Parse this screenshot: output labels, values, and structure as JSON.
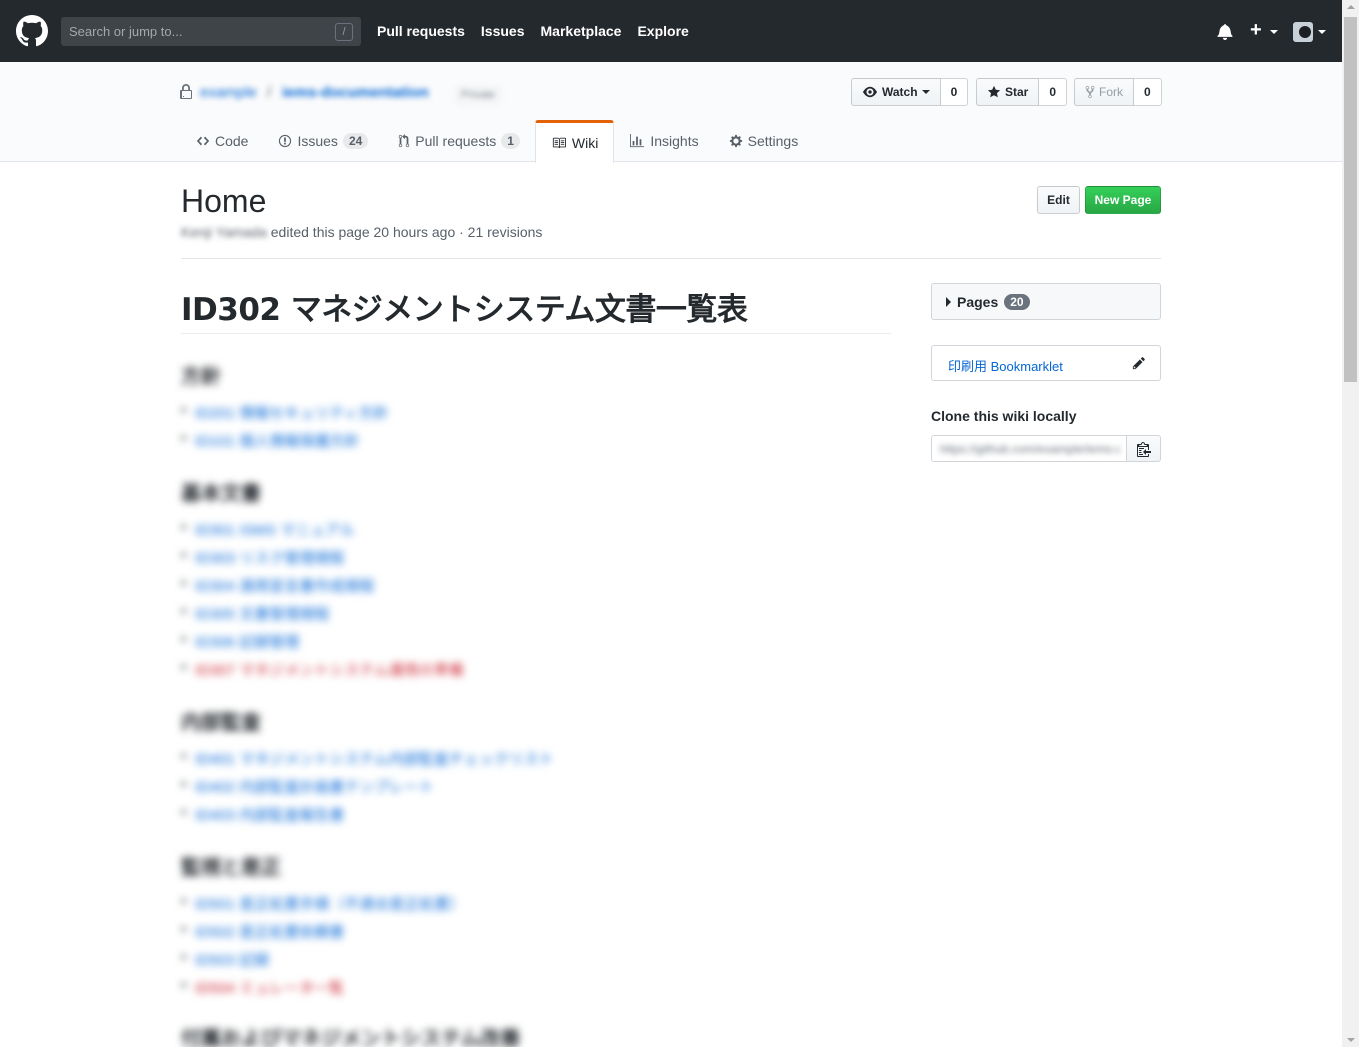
{
  "header": {
    "search_placeholder": "Search or jump to...",
    "search_shortcut": "/",
    "nav": [
      "Pull requests",
      "Issues",
      "Marketplace",
      "Explore"
    ]
  },
  "repo": {
    "owner": "example",
    "slash": "/",
    "name": "iems-documentation",
    "visibility": "Private",
    "watch_label": "Watch",
    "watch_count": "0",
    "star_label": "Star",
    "star_count": "0",
    "fork_label": "Fork",
    "fork_count": "0"
  },
  "tabs": [
    {
      "label": "Code",
      "icon": "code-icon",
      "count": ""
    },
    {
      "label": "Issues",
      "icon": "issue-icon",
      "count": "24"
    },
    {
      "label": "Pull requests",
      "icon": "pull-request-icon",
      "count": "1"
    },
    {
      "label": "Wiki",
      "icon": "book-icon",
      "count": ""
    },
    {
      "label": "Insights",
      "icon": "graph-icon",
      "count": ""
    },
    {
      "label": "Settings",
      "icon": "gear-icon",
      "count": ""
    }
  ],
  "page": {
    "title": "Home",
    "author": "Kenji Yamada",
    "meta_text": "edited this page 20 hours ago · 21 revisions",
    "edit_label": "Edit",
    "new_page_label": "New Page"
  },
  "wiki": {
    "heading": "ID302 マネジメントシステム文書一覧表",
    "sections": [
      {
        "title": "方針",
        "items": [
          {
            "text": "ID201 情報セキュリティ方針",
            "color": "blue"
          },
          {
            "text": "ID101 個人情報保護方針",
            "color": "blue"
          }
        ]
      },
      {
        "title": "基本文書",
        "items": [
          {
            "text": "ID301 ISMS マニュアル",
            "color": "blue"
          },
          {
            "text": "ID303 リスク管理規程",
            "color": "blue"
          },
          {
            "text": "ID304 適用宣言書作成規程",
            "color": "blue"
          },
          {
            "text": "ID305 文書管理規程",
            "color": "blue"
          },
          {
            "text": "ID306 記録管理",
            "color": "blue"
          },
          {
            "text": "ID307 マネジメントシステム運用の準備",
            "color": "red"
          }
        ]
      },
      {
        "title": "内部監査",
        "items": [
          {
            "text": "ID401 マネジメントシステム内部監査チェックリスト",
            "color": "blue"
          },
          {
            "text": "ID402 内部監査計画書テンプレート",
            "color": "blue"
          },
          {
            "text": "ID403 内部監査報告書",
            "color": "blue"
          }
        ]
      },
      {
        "title": "監視と是正",
        "items": [
          {
            "text": "ID501 是正処置手順（不適合是正処置）",
            "color": "blue"
          },
          {
            "text": "ID502 是正処置依頼書",
            "color": "blue"
          },
          {
            "text": "ID503 記録",
            "color": "blue"
          },
          {
            "text": "ID504 ミュレータ一覧",
            "color": "red"
          }
        ]
      },
      {
        "title": "付属およびマネジメントシステム改善",
        "items": []
      }
    ]
  },
  "sidebar": {
    "pages_label": "Pages",
    "pages_count": "20",
    "bookmarklet_label": "印刷用 Bookmarklet",
    "clone_title": "Clone this wiki locally",
    "clone_url": "https://github.com/example/iems-documentation.wiki.git"
  },
  "colors": {
    "header_bg": "#24292e",
    "link": "#0366d6",
    "primary_button": "#28a745",
    "selected_tab_accent": "#e36209",
    "deleted_link": "#cb2431"
  }
}
